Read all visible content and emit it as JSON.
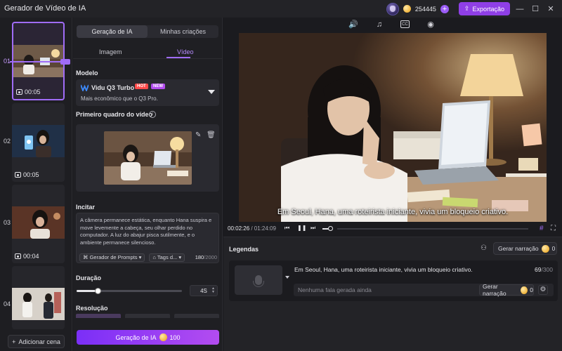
{
  "window": {
    "title": "Gerador de Vídeo de IA",
    "coins": "254445",
    "export_label": "Exportação"
  },
  "scenes": {
    "items": [
      {
        "num": "01",
        "duration": "00:05"
      },
      {
        "num": "02",
        "duration": "00:05"
      },
      {
        "num": "03",
        "duration": "00:04"
      },
      {
        "num": "04",
        "duration": ""
      }
    ],
    "add_label": "Adicionar cena"
  },
  "panel": {
    "tabs": [
      "Geração de IA",
      "Minhas criações"
    ],
    "subtabs": [
      "Imagem",
      "Vídeo"
    ],
    "model_label": "Modelo",
    "model_name": "Vidu Q3 Turbo",
    "badge_hot": "HOT",
    "badge_new": "NEW",
    "model_desc": "Mais econômico que o Q3 Pro.",
    "first_frame_label": "Primeiro quadro do vídeo",
    "prompt_label": "Incitar",
    "prompt_text": "A câmera permanece estática, enquanto Hana suspira e move levemente a cabeça, seu olhar perdido no computador. A luz do abajur pisca sutilmente, e o ambiente permanece silencioso.",
    "prompt_generator": "Gerador de Prompts",
    "tags_label": "Tags d...",
    "char_count": "180",
    "char_max": "/2000",
    "duration_label": "Duração",
    "duration_value": "4S",
    "duration_fraction": 0.2,
    "resolution_label": "Resolução",
    "generate_label": "Geração de IA",
    "generate_cost": "100"
  },
  "player": {
    "subtitle": "Em Seoul, Hana, uma roteirista iniciante, vivia um bloqueio criativo.",
    "current_time": "00:02:26",
    "total_time": " / 01:24:09"
  },
  "captions": {
    "title": "Legendas",
    "narrate_label": "Gerar narração",
    "narrate_cost": "0",
    "item_text": "Em Seoul, Hana, uma roteirista iniciante, vivia um bloqueio criativo.",
    "item_count": "69",
    "item_max": "/300",
    "empty_text": "Nenhuma fala gerada ainda",
    "item_narrate_label": "Gerar narração",
    "item_narrate_cost": "0"
  },
  "colors": {
    "accent": "#a06cf7",
    "export": "#8f3fe6",
    "hot": "#ff4b4b",
    "new": "#b44cf0"
  }
}
